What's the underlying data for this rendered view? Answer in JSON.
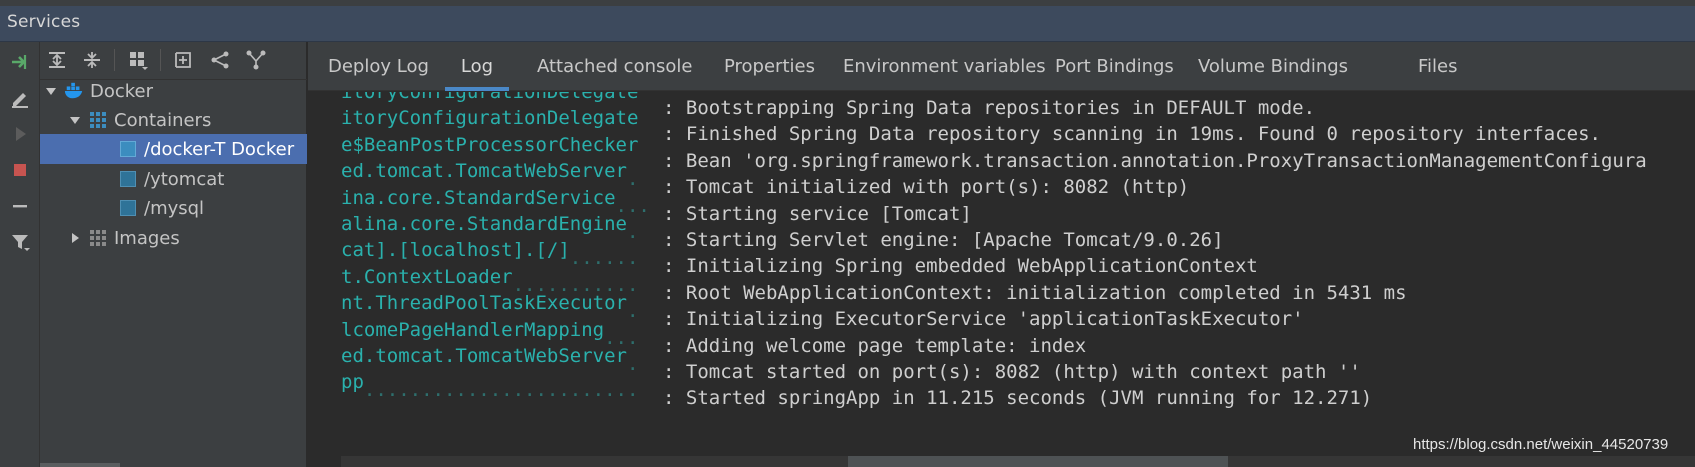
{
  "window": {
    "title": "Services"
  },
  "actions": [
    {
      "name": "run-icon",
      "color": "#59a869"
    },
    {
      "name": "edit-icon"
    },
    {
      "name": "start-icon"
    },
    {
      "name": "stop-icon",
      "color": "#c75450"
    },
    {
      "name": "remove-icon"
    },
    {
      "name": "filter-icon"
    }
  ],
  "tree_toolbar": [
    "expand-all-icon",
    "collapse-all-icon",
    "group-services-icon",
    "add-service-icon",
    "link-icon",
    "branch-icon"
  ],
  "tree": {
    "docker_label": "Docker",
    "containers_label": "Containers",
    "containers": [
      {
        "label": "/docker-T Docker",
        "selected": true
      },
      {
        "label": "/ytomcat",
        "selected": false
      },
      {
        "label": "/mysql",
        "selected": false
      }
    ],
    "images_label": "Images"
  },
  "tabs": [
    {
      "label": "Deploy Log"
    },
    {
      "label": "Log",
      "active": true
    },
    {
      "label": "Attached console"
    },
    {
      "label": "Properties"
    },
    {
      "label": "Environment variables"
    },
    {
      "label": "Port Bindings"
    },
    {
      "label": "Volume Bindings"
    },
    {
      "label": "Files"
    }
  ],
  "log": [
    {
      "src": "itoryConfigurationDelegate",
      "dots": "",
      "msg": ": Bootstrapping Spring Data repositories in DEFAULT mode."
    },
    {
      "src": "itoryConfigurationDelegate",
      "dots": "",
      "msg": ": Finished Spring Data repository scanning in 19ms. Found 0 repository interfaces."
    },
    {
      "src": "e$BeanPostProcessorChecker",
      "dots": "",
      "msg": ": Bean 'org.springframework.transaction.annotation.ProxyTransactionManagementConfigura"
    },
    {
      "src": "ed.tomcat.TomcatWebServer",
      "dots": ".",
      "msg": ": Tomcat initialized with port(s): 8082 (http)"
    },
    {
      "src": "ina.core.StandardService",
      "dots": "...",
      "msg": ": Starting service [Tomcat]"
    },
    {
      "src": "alina.core.StandardEngine",
      "dots": ".",
      "msg": ": Starting Servlet engine: [Apache Tomcat/9.0.26]"
    },
    {
      "src": "cat].[localhost].[/]",
      "dots": "......",
      "msg": ": Initializing Spring embedded WebApplicationContext"
    },
    {
      "src": "t.ContextLoader",
      "dots": "...........",
      "msg": ": Root WebApplicationContext: initialization completed in 5431 ms"
    },
    {
      "src": "nt.ThreadPoolTaskExecutor",
      "dots": ".",
      "msg": ": Initializing ExecutorService 'applicationTaskExecutor'"
    },
    {
      "src": "lcomePageHandlerMapping",
      "dots": "...",
      "msg": ": Adding welcome page template: index"
    },
    {
      "src": "ed.tomcat.TomcatWebServer",
      "dots": ".",
      "msg": ": Tomcat started on port(s): 8082 (http) with context path ''"
    },
    {
      "src": "pp",
      "dots": "........................",
      "msg": ": Started springApp in 11.215 seconds (JVM running for 12.271)"
    }
  ],
  "watermark": "https://blog.csdn.net/weixin_44520739"
}
